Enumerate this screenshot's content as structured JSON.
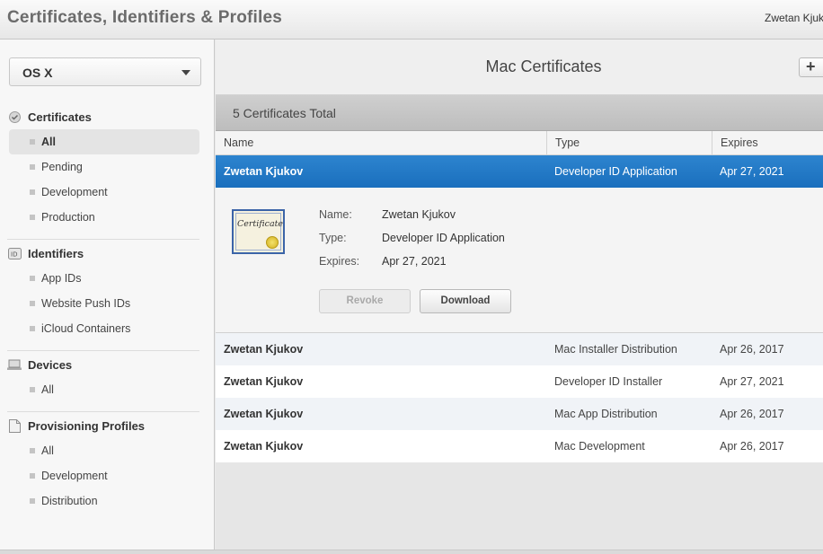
{
  "header": {
    "title": "Certificates, Identifiers & Profiles",
    "user": "Zwetan Kjukov"
  },
  "sidebar": {
    "platform": "OS X",
    "sections": [
      {
        "label": "Certificates",
        "icon": "certificate-badge-icon",
        "items": [
          "All",
          "Pending",
          "Development",
          "Production"
        ],
        "active": "All"
      },
      {
        "label": "Identifiers",
        "icon": "id-icon",
        "items": [
          "App IDs",
          "Website Push IDs",
          "iCloud Containers"
        ]
      },
      {
        "label": "Devices",
        "icon": "laptop-icon",
        "items": [
          "All"
        ]
      },
      {
        "label": "Provisioning Profiles",
        "icon": "document-icon",
        "items": [
          "All",
          "Development",
          "Distribution"
        ]
      }
    ]
  },
  "main": {
    "title": "Mac Certificates",
    "add_label": "+",
    "total": "5 Certificates Total",
    "columns": [
      "Name",
      "Type",
      "Expires"
    ],
    "rows": [
      {
        "name": "Zwetan Kjukov",
        "type": "Developer ID Application",
        "expires": "Apr 27, 2021"
      },
      {
        "name": "Zwetan Kjukov",
        "type": "Mac Installer Distribution",
        "expires": "Apr 26, 2017"
      },
      {
        "name": "Zwetan Kjukov",
        "type": "Developer ID Installer",
        "expires": "Apr 27, 2021"
      },
      {
        "name": "Zwetan Kjukov",
        "type": "Mac App Distribution",
        "expires": "Apr 26, 2017"
      },
      {
        "name": "Zwetan Kjukov",
        "type": "Mac Development",
        "expires": "Apr 26, 2017"
      }
    ],
    "detail": {
      "icon_text": "Certificate",
      "name_key": "Name:",
      "name_val": "Zwetan Kjukov",
      "type_key": "Type:",
      "type_val": "Developer ID Application",
      "expires_key": "Expires:",
      "expires_val": "Apr 27, 2021",
      "revoke_label": "Revoke",
      "download_label": "Download"
    }
  },
  "colors": {
    "selection": "#1f74c3",
    "accent_seal": "#e2c63c"
  }
}
